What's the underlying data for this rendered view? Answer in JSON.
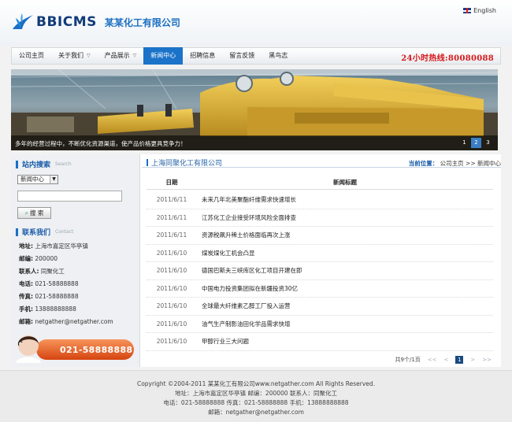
{
  "header": {
    "logo_text": "BBICMS",
    "company_name": "某某化工有限公司",
    "language": "English"
  },
  "nav": {
    "items": [
      {
        "label": "公司主页",
        "dropdown": false,
        "active": false
      },
      {
        "label": "关于我们",
        "dropdown": true,
        "active": false
      },
      {
        "label": "产品展示",
        "dropdown": true,
        "active": false
      },
      {
        "label": "新闻中心",
        "dropdown": false,
        "active": true
      },
      {
        "label": "招聘信息",
        "dropdown": false,
        "active": false
      },
      {
        "label": "留言反馈",
        "dropdown": false,
        "active": false
      },
      {
        "label": "黑鸟志",
        "dropdown": false,
        "active": false
      }
    ],
    "hotline": "24小时热线:80080088"
  },
  "banner": {
    "caption": "多年的经营过程中，不断优化资源渠道，使产品价格更具竞争力！",
    "slides": [
      "1",
      "2",
      "3"
    ],
    "active_slide": "2"
  },
  "sidebar": {
    "search_title": "站内搜索",
    "search_title_en": "Search",
    "search_scope": "新闻中心",
    "search_input_value": "",
    "search_button": "搜 索",
    "contact_title": "联系我们",
    "contact_title_en": "Contact",
    "contact": [
      {
        "label": "地址:",
        "value": "上海市嘉定区华亭镇"
      },
      {
        "label": "邮编:",
        "value": "200000"
      },
      {
        "label": "联系人:",
        "value": "同聚化工"
      },
      {
        "label": "电话:",
        "value": "021-58888888"
      },
      {
        "label": "传真:",
        "value": "021-58888888"
      },
      {
        "label": "手机:",
        "value": "13888888888"
      },
      {
        "label": "邮箱:",
        "value": "netgather@netgather.com"
      }
    ],
    "phone_banner": "021-58888888"
  },
  "content": {
    "section_title": "上海同聚化工有限公司",
    "breadcrumb_label": "当前位置：",
    "breadcrumb_home": "公司主页",
    "breadcrumb_sep": ">>",
    "breadcrumb_current": "新闻中心",
    "columns": [
      "日期",
      "新闻标题"
    ],
    "rows": [
      {
        "date": "2011/6/11",
        "title": "未来几年北美聚酯纤维需求快速增长"
      },
      {
        "date": "2011/6/11",
        "title": "江苏化工企业接受环境风险全面排查"
      },
      {
        "date": "2011/6/11",
        "title": "资源税飙升稀土价格面临再次上涨"
      },
      {
        "date": "2011/6/10",
        "title": "煤炭煤化工机会凸显"
      },
      {
        "date": "2011/6/10",
        "title": "德国巴斯夫三峡库区化工项目开建在即"
      },
      {
        "date": "2011/6/10",
        "title": "中国电力投资集团拟在新疆投资30亿"
      },
      {
        "date": "2011/6/10",
        "title": "全球最大纤维素乙醇工厂投入运营"
      },
      {
        "date": "2011/6/10",
        "title": "油气生产制影油田化学品需求快增"
      },
      {
        "date": "2011/6/10",
        "title": "甲醇行业三大问题"
      }
    ],
    "pager": {
      "summary": "共9个/1页",
      "first": "<<",
      "prev": "<",
      "current": "1",
      "next": ">",
      "last": ">>"
    }
  },
  "footer": {
    "copyright": "Copyright ©2004-2011 某某化工有限公司www.netgather.com All Rights Reserved.",
    "address_line": "地址：上海市嘉定区华亭镇   邮编：200000   联系人：同聚化工",
    "phone_line": "电话：021-58888888   传真：021-58888888   手机：13888888888",
    "email_line": "邮箱：netgather@netgather.com"
  },
  "colors": {
    "primary": "#1a73c9",
    "hotline": "#d7191b",
    "phone_banner": "#e8561c"
  }
}
